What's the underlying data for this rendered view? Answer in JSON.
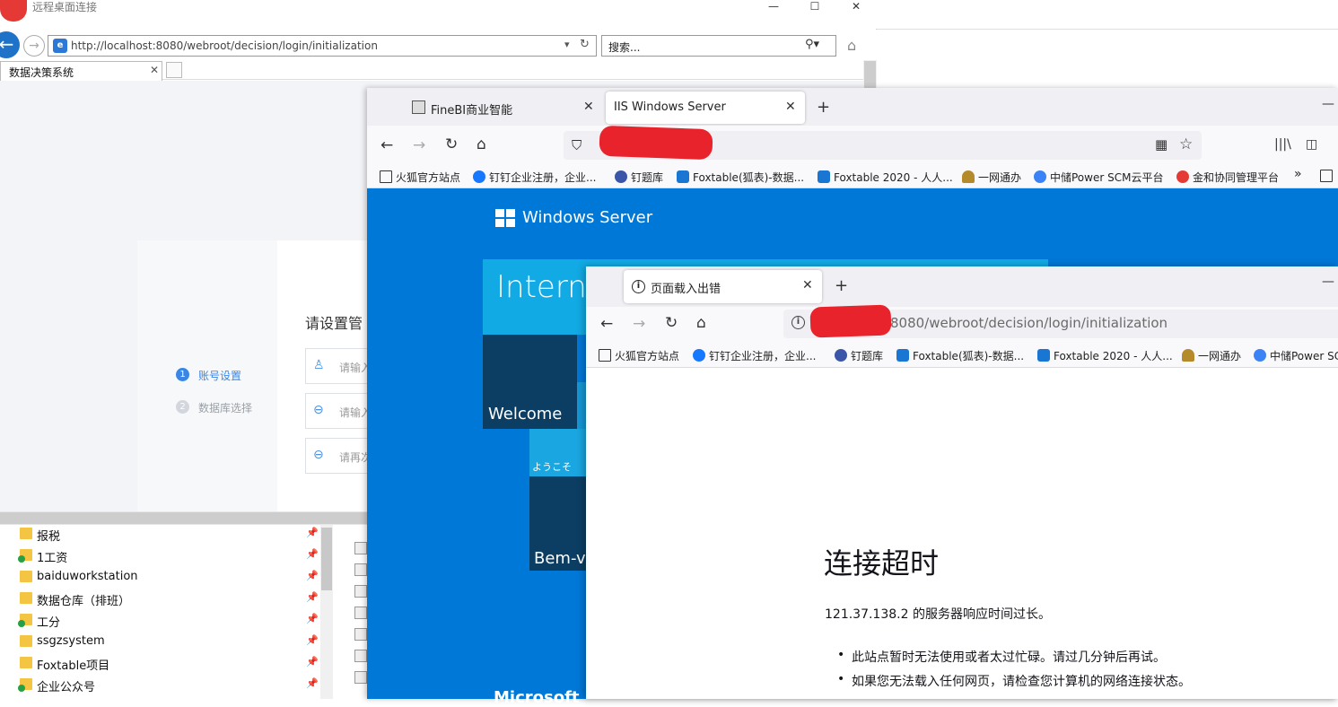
{
  "rdp": {
    "title": "远程桌面连接",
    "min": "—",
    "max": "☐",
    "close": "✕"
  },
  "ie": {
    "url": "http://localhost:8080/webroot/decision/login/initialization",
    "search_placeholder": "搜索...",
    "tab_label": "数据决策系统",
    "tab_close": "✕"
  },
  "login": {
    "heading": "请设置管",
    "steps": [
      {
        "num": "1",
        "label": "账号设置"
      },
      {
        "num": "2",
        "label": "数据库选择"
      }
    ],
    "fields": [
      {
        "placeholder": "请输入"
      },
      {
        "placeholder": "请输入"
      },
      {
        "placeholder": "请再次"
      }
    ]
  },
  "explorer": {
    "items": [
      {
        "label": "报税",
        "badge": false
      },
      {
        "label": "1工资",
        "badge": true
      },
      {
        "label": "baiduworkstation",
        "badge": false
      },
      {
        "label": "数据仓库（排班）",
        "badge": false
      },
      {
        "label": "工分",
        "badge": true
      },
      {
        "label": "ssgzsystem",
        "badge": false
      },
      {
        "label": "Foxtable项目",
        "badge": false
      },
      {
        "label": "企业公众号",
        "badge": true
      }
    ]
  },
  "ff1": {
    "tabs": [
      {
        "label": "FineBI商业智能"
      },
      {
        "label": "IIS Windows Server"
      }
    ],
    "bookmarks": [
      "火狐官方站点",
      "钉钉企业注册，企业...",
      "钉题库",
      "Foxtable(狐表)-数据...",
      "Foxtable 2020 - 人人...",
      "一网通办",
      "中储Power SCM云平台",
      "金和协同管理平台"
    ],
    "more_bookmarks": "»"
  },
  "iis": {
    "logo_text": "Windows Server",
    "banner_text": "Interne",
    "tile_welcome": "Welcome",
    "tile_yokoso": "ようこそ",
    "tile_bem": "Bem-vi",
    "footer": "Microsoft"
  },
  "ff2": {
    "tab_label": "页面载入出错",
    "url": "8080/webroot/decision/login/initialization",
    "bookmarks": [
      "火狐官方站点",
      "钉钉企业注册，企业...",
      "钉题库",
      "Foxtable(狐表)-数据...",
      "Foxtable 2020 - 人人...",
      "一网通办",
      "中储Power SC"
    ],
    "error_title": "连接超时",
    "error_desc": "121.37.138.2 的服务器响应时间过长。",
    "error_items": [
      "此站点暂时无法使用或者太过忙碌。请过几分钟后再试。",
      "如果您无法载入任何网页，请检查您计算机的网络连接状态。"
    ]
  },
  "colors": {
    "iis_blue": "#0078d7",
    "iis_cyan": "#12aae4",
    "iis_navy": "#0c3e63",
    "login_accent": "#3a86e6",
    "redaction": "#e9232b"
  }
}
